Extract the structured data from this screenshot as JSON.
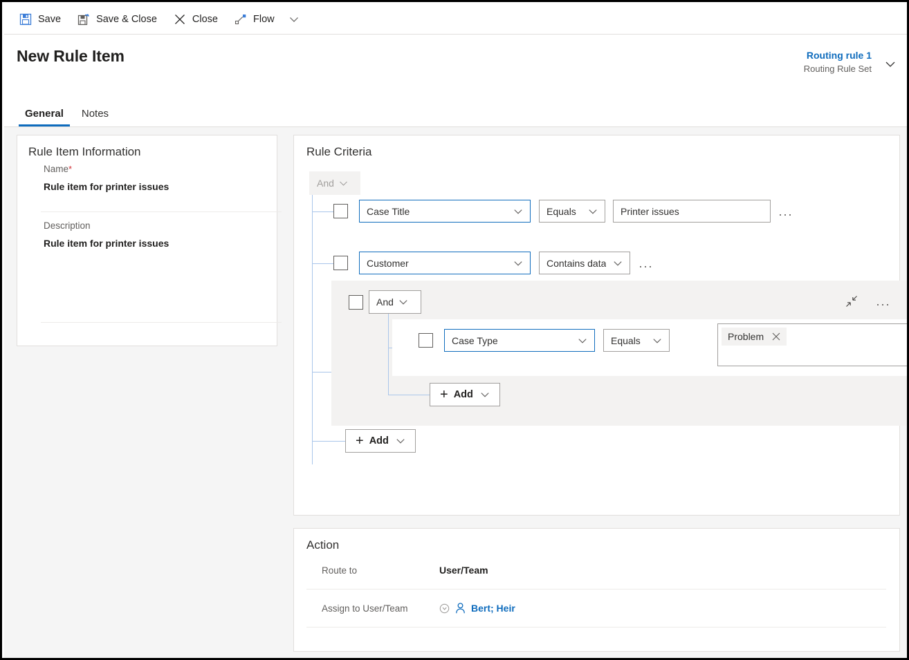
{
  "command_bar": {
    "items": [
      {
        "label": "Save",
        "icon": "save-icon"
      },
      {
        "label": "Save & Close",
        "icon": "save-and-close-icon"
      },
      {
        "label": "Close",
        "icon": "close-x-icon"
      },
      {
        "label": "Flow",
        "icon": "flow-icon"
      }
    ],
    "overflow_chevron": "chevron-down-icon"
  },
  "header": {
    "title": "New Rule Item",
    "record_name": "Routing rule 1",
    "record_subtitle": "Routing Rule Set",
    "collapse_chevron": "chevron-down-icon",
    "tabs": [
      {
        "label": "General",
        "active": true
      },
      {
        "label": "Notes",
        "active": false
      }
    ]
  },
  "rule_item_information": {
    "section_title": "Rule Item Information",
    "fields": [
      {
        "label": "Name",
        "required": "*",
        "value": "Rule item for printer issues"
      },
      {
        "label": "Description",
        "required": "",
        "value": "Rule item for printer issues"
      }
    ]
  },
  "rule_criteria": {
    "section_title": "Rule Criteria",
    "root_operator": "And",
    "rows": [
      {
        "attribute": "Case Title",
        "operator": "Equals",
        "value": "Printer issues",
        "has_value_box": true,
        "more_label": "..."
      },
      {
        "attribute": "Customer",
        "operator": "Contains data",
        "value": "",
        "has_value_box": false,
        "more_label": "..."
      }
    ],
    "group": {
      "operator": "And",
      "collapse_icon": "collapse-icon",
      "more_label": "...",
      "rows": [
        {
          "attribute": "Case Type",
          "operator": "Equals",
          "tags": [
            {
              "label": "Problem",
              "remove_icon": "close-x-icon"
            }
          ],
          "more_label": "..."
        }
      ],
      "add_label": "Add"
    },
    "add_label": "Add"
  },
  "action": {
    "section_title": "Action",
    "rows": [
      {
        "label": "Route to",
        "value": "User/Team",
        "type": "text"
      },
      {
        "label": "Assign to User/Team",
        "value": "Bert; Heir",
        "type": "lookup",
        "status_icon": "recent-items-icon",
        "entity_icon": "user-icon"
      }
    ]
  },
  "colors": {
    "accent": "#0f6cbd",
    "tree_line": "#a9c5ea",
    "required": "#d13438",
    "group_bg": "#f3f2f1",
    "page_bg": "#f5f5f5"
  }
}
